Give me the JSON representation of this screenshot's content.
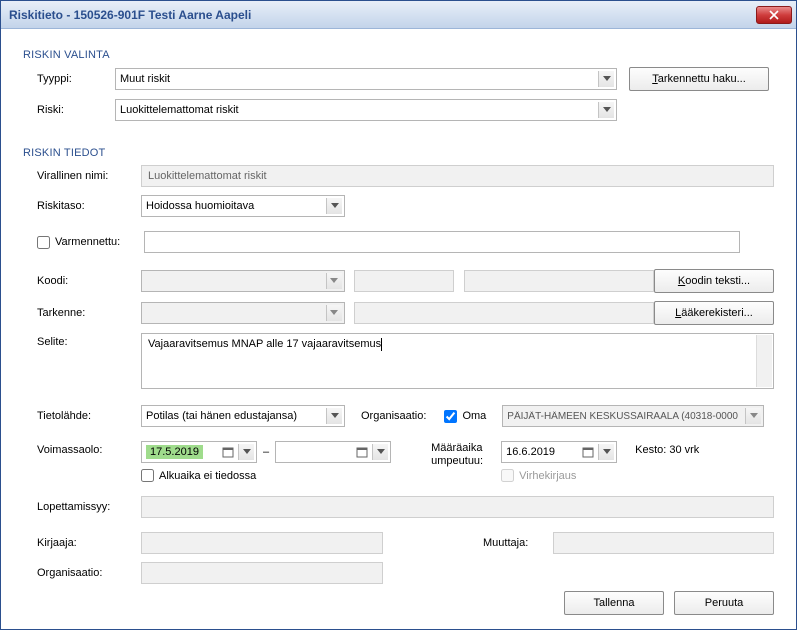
{
  "title": "Riskitieto - 150526-901F Testi Aarne Aapeli",
  "section1": {
    "header": "RISKIN VALINTA",
    "tyyppi_label": "Tyyppi:",
    "tyyppi_value": "Muut riskit",
    "riski_label": "Riski:",
    "riski_value": "Luokittelemattomat riskit",
    "tarkennettu_haku": "Tarkennettu haku..."
  },
  "section2": {
    "header": "RISKIN TIEDOT",
    "virallinen_label": "Virallinen nimi:",
    "virallinen_value": "Luokittelemattomat riskit",
    "riskitaso_label": "Riskitaso:",
    "riskitaso_value": "Hoidossa huomioitava",
    "varmennettu_label": "Varmennettu:",
    "koodi_label": "Koodi:",
    "koodin_teksti_btn": "Koodin teksti...",
    "tarkenne_label": "Tarkenne:",
    "laakerekisteri_btn": "Lääkerekisteri...",
    "selite_label": "Selite:",
    "selite_value": "Vajaaravitsemus MNAP alle 17 vajaaravitsemus",
    "tietolahde_label": "Tietolähde:",
    "tietolahde_value": "Potilas (tai hänen edustajansa)",
    "organisaatio_label": "Organisaatio:",
    "oma_label": "Oma",
    "organisaatio_value": "PÄIJÄT-HÄMEEN KESKUSSAIRAALA  (40318-0000",
    "voimassaolo_label": "Voimassaolo:",
    "voimassa_from": "17.5.2019",
    "voimassa_to": "",
    "dash": "–",
    "alkuaika_label": "Alkuaika ei tiedossa",
    "maaraaika_label1": "Määräaika",
    "maaraaika_label2": "umpeutuu:",
    "maaraaika_value": "16.6.2019",
    "kesto_label": "Kesto: 30 vrk",
    "virhekirjaus_label": "Virhekirjaus",
    "lopettamissyy_label": "Lopettamissyy:",
    "kirjaaja_label": "Kirjaaja:",
    "muuttaja_label": "Muuttaja:",
    "organisaatio2_label": "Organisaatio:"
  },
  "buttons": {
    "tallenna": "Tallenna",
    "peruuta": "Peruuta"
  }
}
